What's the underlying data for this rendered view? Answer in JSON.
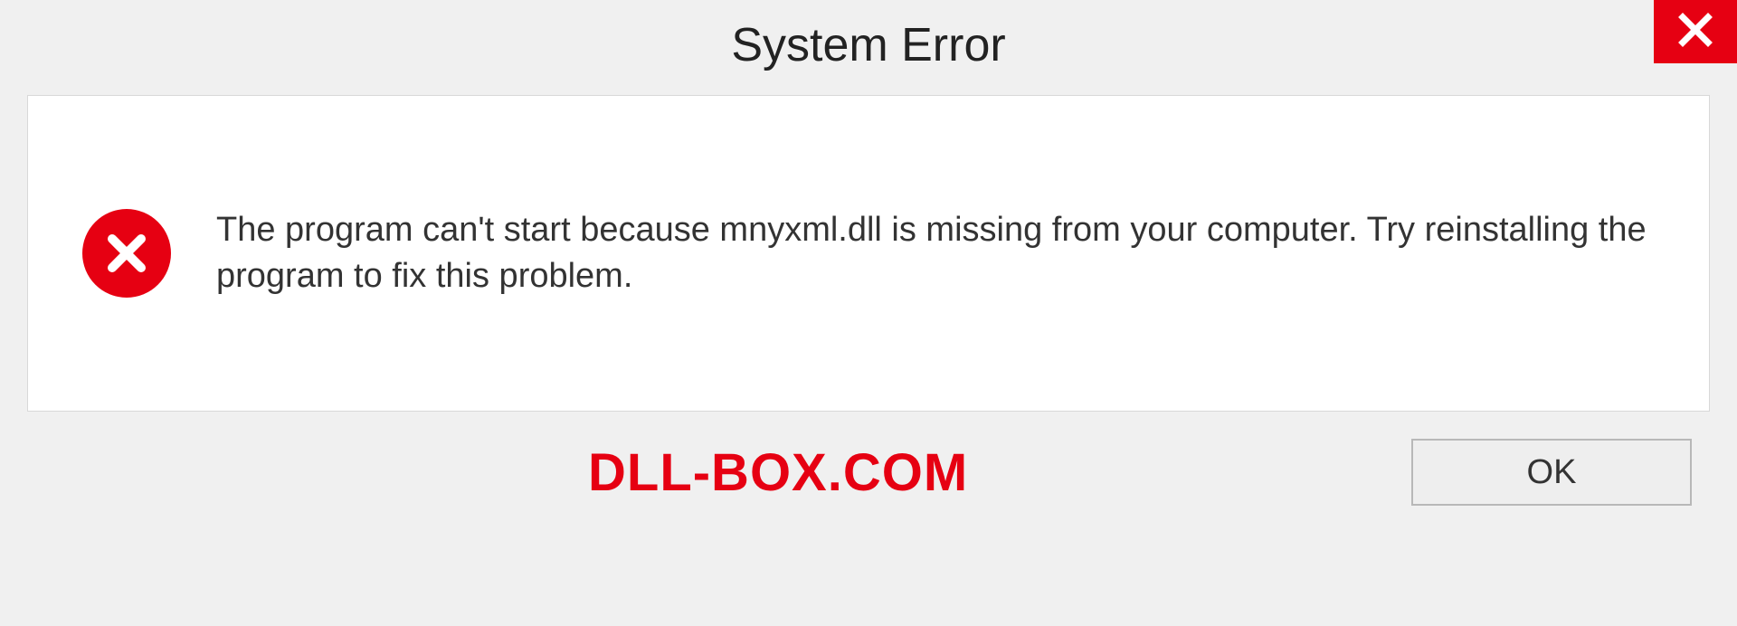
{
  "titlebar": {
    "title": "System Error"
  },
  "body": {
    "message": "The program can't start because mnyxml.dll is missing from your computer. Try reinstalling the program to fix this problem."
  },
  "footer": {
    "watermark": "DLL-BOX.COM",
    "ok_label": "OK"
  },
  "colors": {
    "error_red": "#e60012",
    "panel_bg": "#ffffff",
    "page_bg": "#f0f0f0"
  }
}
